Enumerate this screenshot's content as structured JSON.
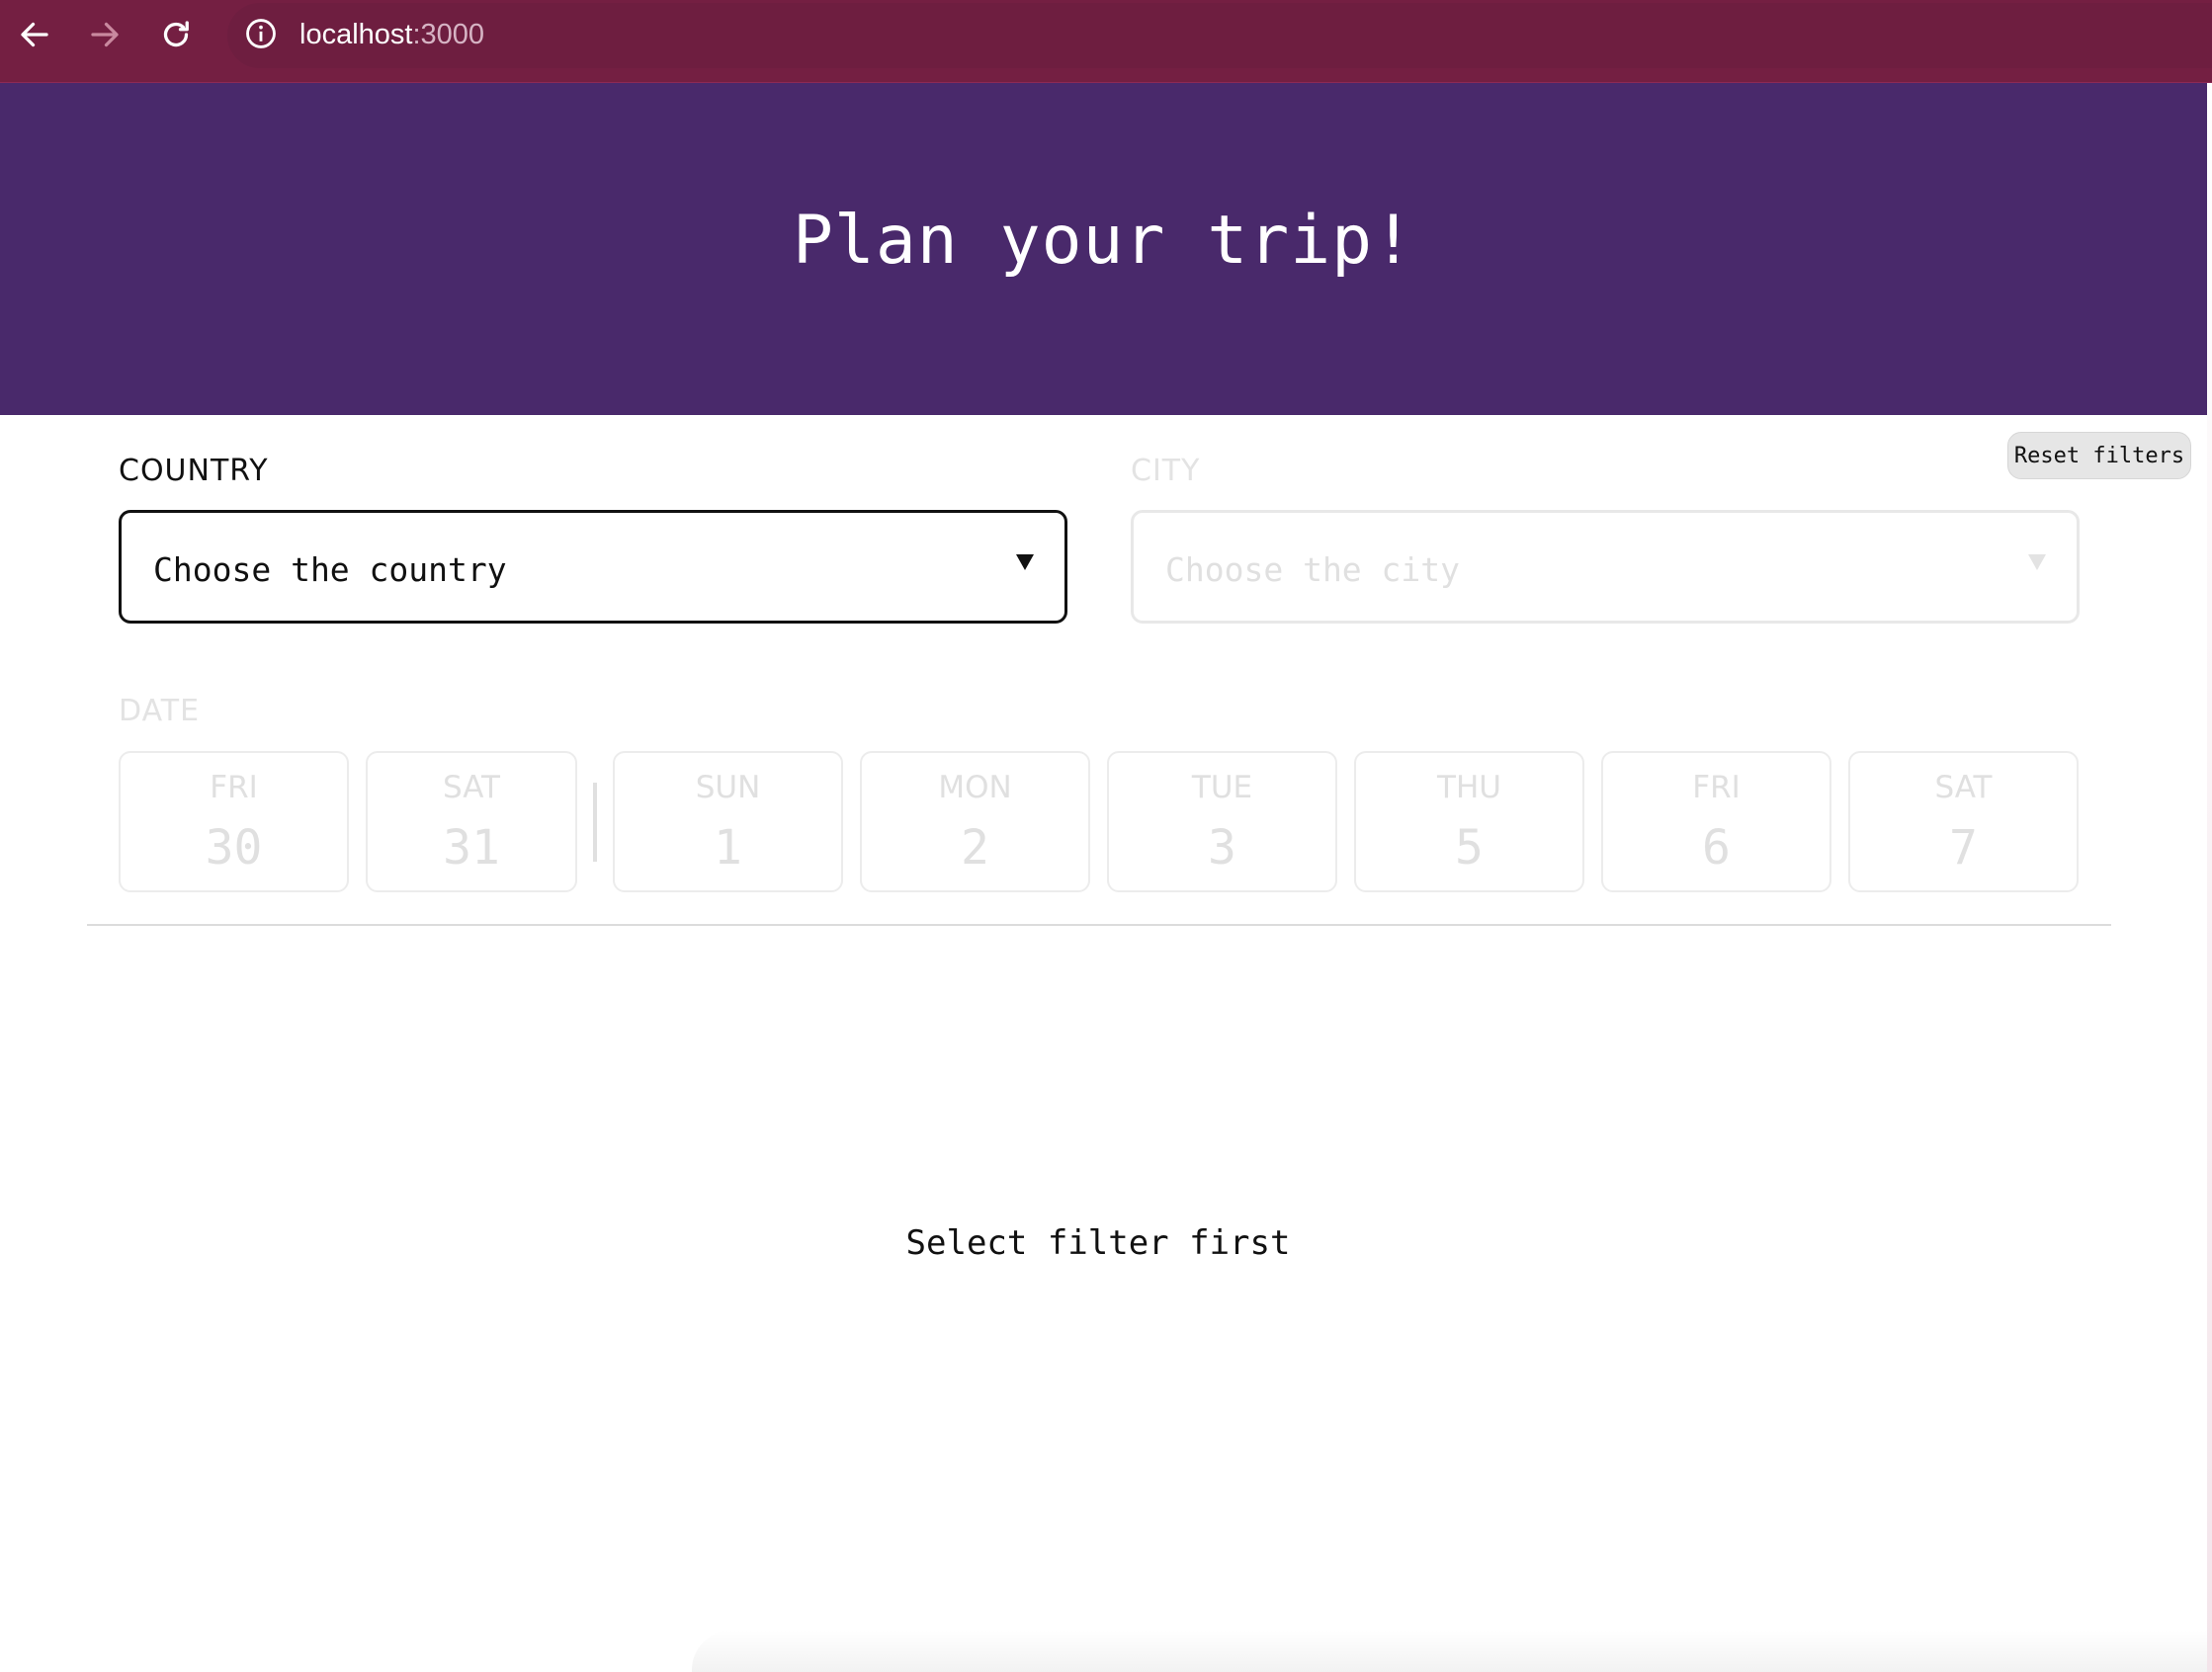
{
  "browser": {
    "url_host": "localhost",
    "url_port": ":3000",
    "icons": [
      "back-arrow-icon",
      "forward-arrow-icon",
      "reload-icon",
      "site-info-icon"
    ]
  },
  "header": {
    "title": "Plan your trip!"
  },
  "toolbar": {
    "reset_label": "Reset filters"
  },
  "filters": {
    "country": {
      "label": "COUNTRY",
      "placeholder": "Choose the country",
      "enabled": true
    },
    "city": {
      "label": "CITY",
      "placeholder": "Choose the city",
      "enabled": false
    },
    "date": {
      "label": "DATE",
      "enabled": false,
      "days": [
        {
          "day": "FRI",
          "num": "30"
        },
        {
          "day": "SAT",
          "num": "31"
        },
        {
          "day": "SUN",
          "num": "1"
        },
        {
          "day": "MON",
          "num": "2"
        },
        {
          "day": "TUE",
          "num": "3"
        },
        {
          "day": "THU",
          "num": "5"
        },
        {
          "day": "FRI",
          "num": "6"
        },
        {
          "day": "SAT",
          "num": "7"
        }
      ]
    }
  },
  "results": {
    "empty_message": "Select filter first"
  },
  "colors": {
    "browser_bar": "#741f42",
    "hero": "#49296b",
    "disabled_text": "#e0e0e0",
    "text": "#111111"
  }
}
